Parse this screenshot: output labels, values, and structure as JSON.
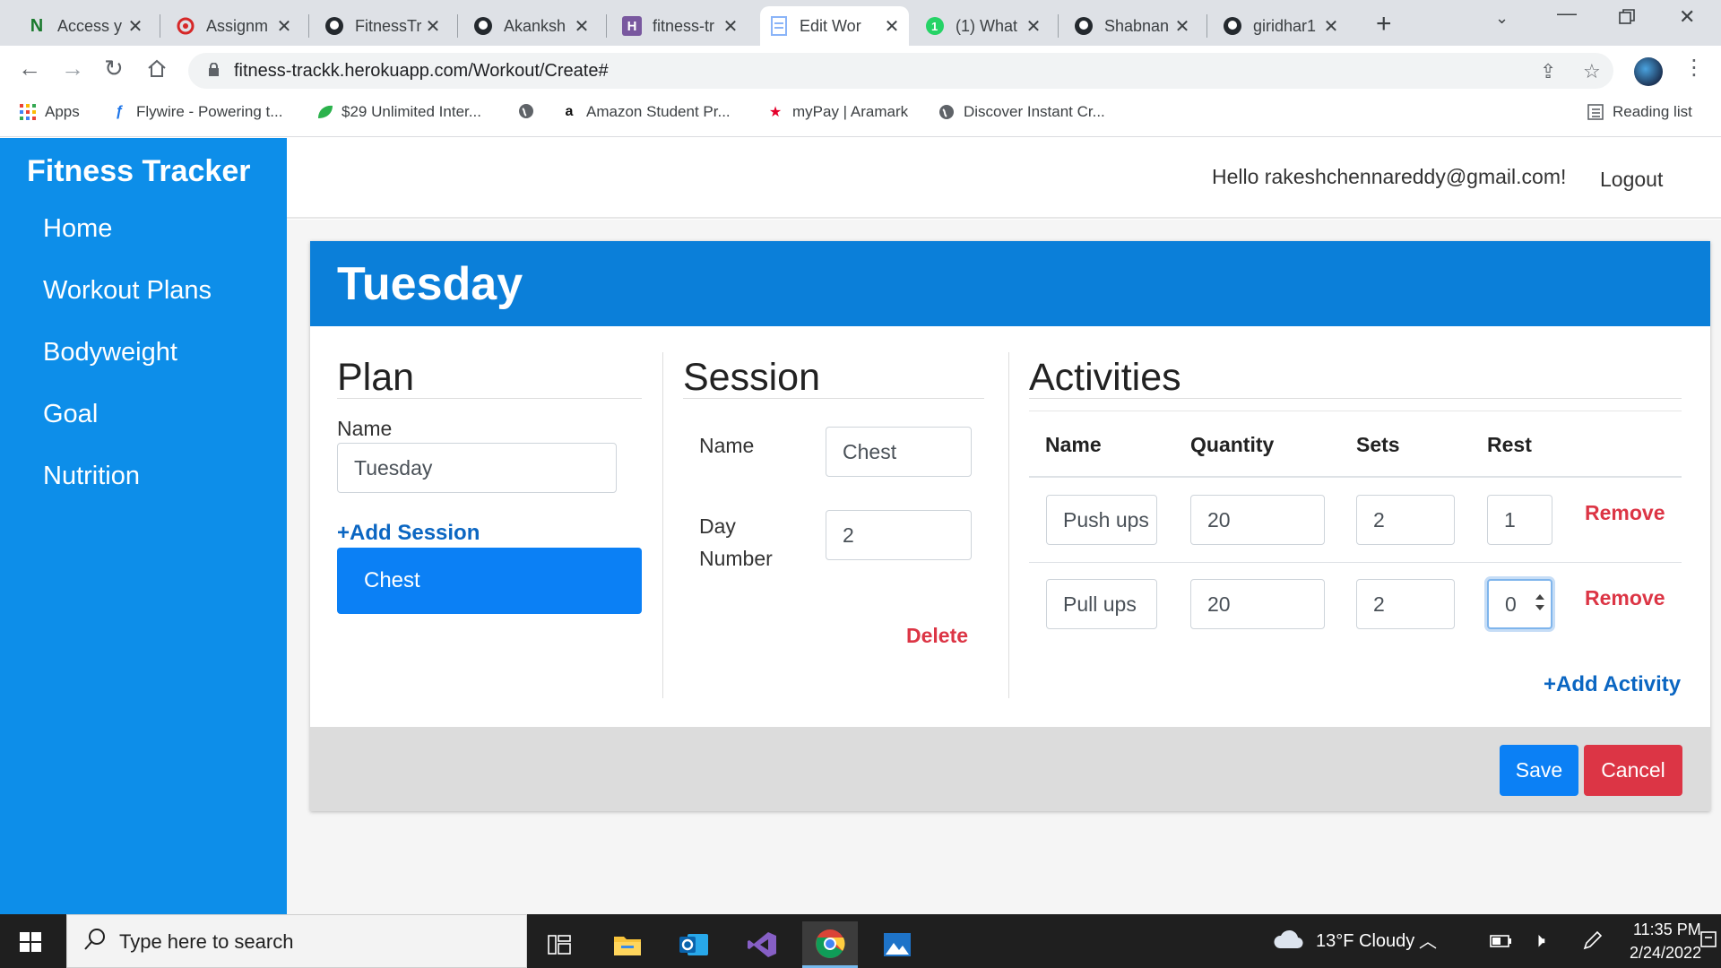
{
  "browser": {
    "tabs": [
      {
        "title": "Access y",
        "icon": "n-logo-icon"
      },
      {
        "title": "Assignm",
        "icon": "assignment-icon"
      },
      {
        "title": "FitnessTr",
        "icon": "github-icon"
      },
      {
        "title": "Akanksh",
        "icon": "github-icon"
      },
      {
        "title": "fitness-tr",
        "icon": "heroku-icon"
      },
      {
        "title": "Edit Wor",
        "icon": "document-icon"
      },
      {
        "title": "(1) What",
        "icon": "whatsapp-icon"
      },
      {
        "title": "Shabnan",
        "icon": "github-icon"
      },
      {
        "title": "giridhar1",
        "icon": "github-icon"
      }
    ],
    "url": "fitness-trackk.herokuapp.com/Workout/Create#",
    "bookmarks": [
      {
        "label": "Apps"
      },
      {
        "label": "Flywire - Powering t..."
      },
      {
        "label": "$29 Unlimited Inter..."
      },
      {
        "label": ""
      },
      {
        "label": "Amazon Student Pr..."
      },
      {
        "label": "myPay | Aramark"
      },
      {
        "label": "Discover Instant Cr..."
      }
    ],
    "reading_list": "Reading list"
  },
  "app": {
    "brand": "Fitness Tracker",
    "nav": [
      "Home",
      "Workout Plans",
      "Bodyweight",
      "Goal",
      "Nutrition"
    ],
    "hello": "Hello rakeshchennareddy@gmail.com!",
    "logout": "Logout"
  },
  "workout": {
    "title": "Tuesday",
    "plan": {
      "heading": "Plan",
      "name_label": "Name",
      "name_value": "Tuesday",
      "add_session": "+Add Session",
      "sessions": [
        "Chest"
      ]
    },
    "session": {
      "heading": "Session",
      "name_label": "Name",
      "name_value": "Chest",
      "day_label_1": "Day",
      "day_label_2": "Number",
      "day_value": "2",
      "delete": "Delete"
    },
    "activities": {
      "heading": "Activities",
      "columns": [
        "Name",
        "Quantity",
        "Sets",
        "Rest"
      ],
      "rows": [
        {
          "name": "Push ups",
          "quantity": "20",
          "sets": "2",
          "rest": "1"
        },
        {
          "name": "Pull ups",
          "quantity": "20",
          "sets": "2",
          "rest": "0"
        }
      ],
      "remove": "Remove",
      "add_activity": "+Add Activity"
    },
    "save": "Save",
    "cancel": "Cancel"
  },
  "taskbar": {
    "search_placeholder": "Type here to search",
    "weather": "13°F  Cloudy",
    "time": "11:35 PM",
    "date": "2/24/2022"
  },
  "colors": {
    "sidebar": "#0d8ee9",
    "card_header": "#0b7fd9",
    "primary": "#0b80f5",
    "danger": "#dc3545",
    "link": "#0b66c2"
  }
}
